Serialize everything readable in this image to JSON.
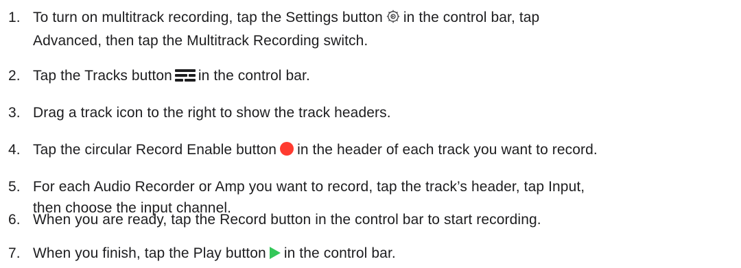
{
  "steps": [
    {
      "number": "1.",
      "line1_before": "To turn on multitrack recording, tap the Settings button",
      "icon": "settings-gear-icon",
      "line1_after": "in the control bar, tap",
      "line2": "Advanced, then tap the Multitrack Recording switch."
    },
    {
      "number": "2.",
      "before": "Tap the Tracks button",
      "icon": "tracks-icon",
      "after": "in the control bar."
    },
    {
      "number": "3.",
      "text": "Drag a track icon to the right to show the track headers."
    },
    {
      "number": "4.",
      "before": "Tap the circular Record Enable button",
      "icon": "record-enable-icon",
      "after": "in the header of each track you want to record."
    },
    {
      "number": "5.",
      "line1": "For each Audio Recorder or Amp you want to record, tap the track’s header, tap Input,",
      "line2": "then choose the input channel."
    },
    {
      "number": "6.",
      "text": "When you are ready, tap the Record button in the control bar to start recording."
    },
    {
      "number": "7.",
      "before": "When you finish, tap the Play button",
      "icon": "play-icon",
      "after": "in the control bar."
    }
  ],
  "colors": {
    "text": "#1d1d1f",
    "record": "#ff3b30",
    "play": "#34c759",
    "tracks_icon": "#1d1d1f",
    "gear_icon": "#3a3a3c"
  }
}
